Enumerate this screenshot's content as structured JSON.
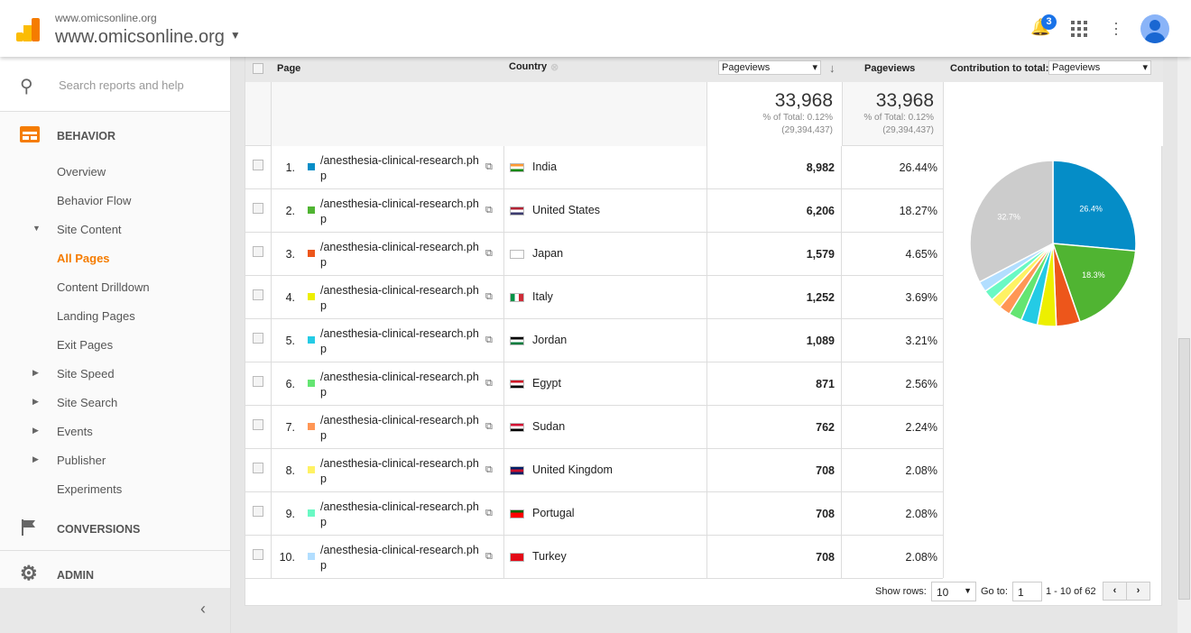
{
  "header": {
    "subtitle": "www.omicsonline.org",
    "property": "www.omicsonline.org",
    "notification_count": "3",
    "icons": [
      "analytics-logo",
      "bell-icon",
      "apps-icon",
      "more-vert-icon",
      "avatar"
    ]
  },
  "sidebar": {
    "search_placeholder": "Search reports and help",
    "behavior": "BEHAVIOR",
    "items": [
      {
        "label": "Overview",
        "arrow": ""
      },
      {
        "label": "Behavior Flow",
        "arrow": ""
      },
      {
        "label": "Site Content",
        "arrow": "▼"
      },
      {
        "label": "All Pages",
        "arrow": "",
        "active": true
      },
      {
        "label": "Content Drilldown",
        "arrow": ""
      },
      {
        "label": "Landing Pages",
        "arrow": ""
      },
      {
        "label": "Exit Pages",
        "arrow": ""
      },
      {
        "label": "Site Speed",
        "arrow": "▶"
      },
      {
        "label": "Site Search",
        "arrow": "▶"
      },
      {
        "label": "Events",
        "arrow": "▶"
      },
      {
        "label": "Publisher",
        "arrow": "▶"
      },
      {
        "label": "Experiments",
        "arrow": ""
      }
    ],
    "conversions": "CONVERSIONS",
    "admin": "ADMIN"
  },
  "table": {
    "col_page": "Page",
    "col_country": "Country",
    "metric_select": "Pageviews",
    "col_pageviews": "Pageviews",
    "contribution_label": "Contribution to total:",
    "contribution_select": "Pageviews",
    "total": {
      "value": "33,968",
      "pct": "% of Total: 0.12%",
      "overall": "(29,394,437)"
    },
    "rows": [
      {
        "n": "1.",
        "page": "/anesthesia-clinical-research.php",
        "country": "India",
        "pv": "8,982",
        "pct": "26.44%",
        "color": "#058dc7"
      },
      {
        "n": "2.",
        "page": "/anesthesia-clinical-research.php",
        "country": "United States",
        "pv": "6,206",
        "pct": "18.27%",
        "color": "#50b432"
      },
      {
        "n": "3.",
        "page": "/anesthesia-clinical-research.php",
        "country": "Japan",
        "pv": "1,579",
        "pct": "4.65%",
        "color": "#ed561b"
      },
      {
        "n": "4.",
        "page": "/anesthesia-clinical-research.php",
        "country": "Italy",
        "pv": "1,252",
        "pct": "3.69%",
        "color": "#edef00"
      },
      {
        "n": "5.",
        "page": "/anesthesia-clinical-research.php",
        "country": "Jordan",
        "pv": "1,089",
        "pct": "3.21%",
        "color": "#24cbe5"
      },
      {
        "n": "6.",
        "page": "/anesthesia-clinical-research.php",
        "country": "Egypt",
        "pv": "871",
        "pct": "2.56%",
        "color": "#64e572"
      },
      {
        "n": "7.",
        "page": "/anesthesia-clinical-research.php",
        "country": "Sudan",
        "pv": "762",
        "pct": "2.24%",
        "color": "#ff9655"
      },
      {
        "n": "8.",
        "page": "/anesthesia-clinical-research.php",
        "country": "United Kingdom",
        "pv": "708",
        "pct": "2.08%",
        "color": "#fff263"
      },
      {
        "n": "9.",
        "page": "/anesthesia-clinical-research.php",
        "country": "Portugal",
        "pv": "708",
        "pct": "2.08%",
        "color": "#6af9c4"
      },
      {
        "n": "10.",
        "page": "/anesthesia-clinical-research.php",
        "country": "Turkey",
        "pv": "708",
        "pct": "2.08%",
        "color": "#b2deff"
      }
    ]
  },
  "pie": {
    "values": [
      26.44,
      18.27,
      4.65,
      3.69,
      3.21,
      2.56,
      2.24,
      2.08,
      2.08,
      2.08,
      32.7
    ],
    "colors": [
      "#058dc7",
      "#50b432",
      "#ed561b",
      "#edef00",
      "#24cbe5",
      "#64e572",
      "#ff9655",
      "#fff263",
      "#6af9c4",
      "#b2deff",
      "#cccccc"
    ],
    "labels": [
      "26.4%",
      "18.3%",
      "",
      "",
      "",
      "",
      "",
      "",
      "",
      "",
      "32.7%"
    ]
  },
  "footer": {
    "show_rows_label": "Show rows:",
    "show_rows": "10",
    "goto_label": "Go to:",
    "goto": "1",
    "range": "1 - 10 of 62",
    "prev": "‹",
    "next": "›"
  }
}
